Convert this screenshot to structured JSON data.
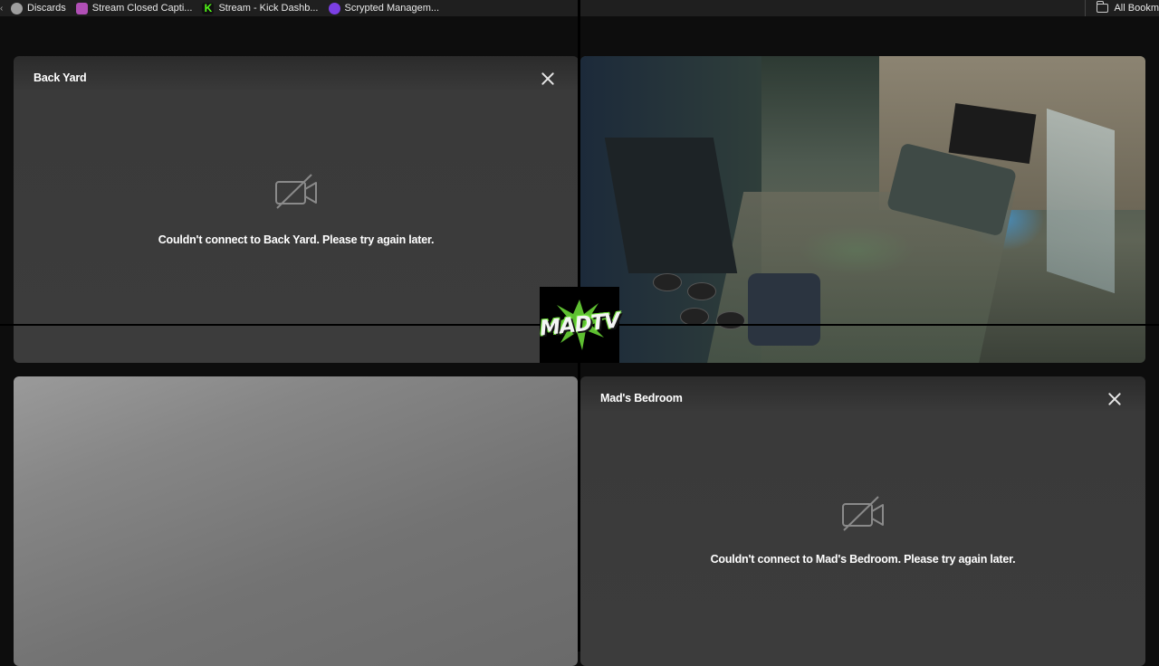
{
  "bookmarks": {
    "items": [
      {
        "label": "Discards",
        "icon": "globe-icon",
        "color": "#9e9e9e"
      },
      {
        "label": "Stream Closed Capti...",
        "icon": "captions-icon",
        "color": "#b04fb5"
      },
      {
        "label": "Stream - Kick Dashb...",
        "icon": "kick-logo-icon",
        "color": "#53fc18"
      },
      {
        "label": "Scrypted Managem...",
        "icon": "scrypted-icon",
        "color": "#7b3fe4"
      }
    ],
    "all_bookmarks": "All Bookm"
  },
  "tiles": {
    "back_yard": {
      "title": "Back Yard",
      "error": "Couldn't connect to Back Yard. Please try again later."
    },
    "mads_bedroom": {
      "title": "Mad's Bedroom",
      "error": "Couldn't connect to Mad's Bedroom. Please try again later."
    }
  },
  "logo": {
    "text": "MADTV",
    "accent": "#6fe03a"
  },
  "colors": {
    "tile_bg": "#3c3c3c",
    "page_bg": "#0d0d0d"
  }
}
